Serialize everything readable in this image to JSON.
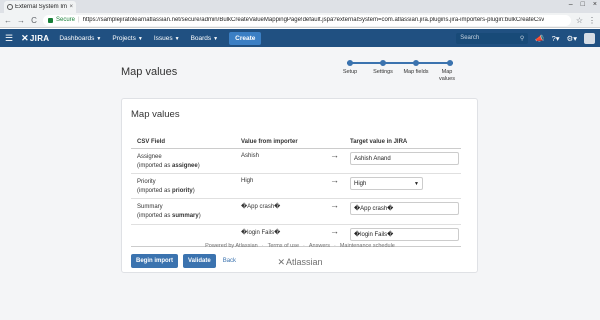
{
  "browser": {
    "tab_title": "External System Import",
    "tab_close": "×",
    "win_minimize": "–",
    "win_maximize": "□",
    "win_close": "×",
    "back": "←",
    "forward": "→",
    "reload": "C",
    "secure_label": "Secure",
    "url": "https://samplejiratolearnatlassian.net/secure/admin/BulkCreateValueMappingPage!default.jspa?externalSystem=com.atlassian.jira.plugins.jira-importers-plugin:bulkCreateCsv"
  },
  "header": {
    "logo": "JIRA",
    "nav": [
      "Dashboards",
      "Projects",
      "Issues",
      "Boards"
    ],
    "create_label": "Create",
    "search_placeholder": "Search",
    "brand_color": "#205081"
  },
  "page": {
    "title": "Map values",
    "steps": [
      "Setup",
      "Settings",
      "Map fields",
      "Map values"
    ]
  },
  "panel": {
    "title": "Map values",
    "columns": [
      "CSV Field",
      "Value from importer",
      "Target value in JIRA"
    ],
    "rows": [
      {
        "field": "Assignee",
        "imported_as_prefix": "(imported as",
        "imported_as": "assignee",
        "imported_as_suffix": ")",
        "value": "Ashish",
        "arrow": "→",
        "target": "Ashish Anand",
        "target_type": "input"
      },
      {
        "field": "Priority",
        "imported_as_prefix": "(imported as",
        "imported_as": "priority",
        "imported_as_suffix": ")",
        "value": "High",
        "arrow": "→",
        "target": "High",
        "target_type": "select"
      },
      {
        "field": "Summary",
        "imported_as_prefix": "(imported as",
        "imported_as": "summary",
        "imported_as_suffix": ")",
        "value": "�App crash�",
        "arrow": "→",
        "target": "�App crash�",
        "target_type": "input"
      }
    ],
    "extra_row": {
      "value": "�login Fails�",
      "arrow": "→",
      "target": "�login Fails�"
    },
    "begin_import_label": "Begin import",
    "validate_label": "Validate",
    "back_label": "Back"
  },
  "footer": {
    "links": [
      "Powered by Atlassian",
      "Terms of use",
      "Answers",
      "Maintenance schedule"
    ],
    "logo": "Atlassian"
  }
}
